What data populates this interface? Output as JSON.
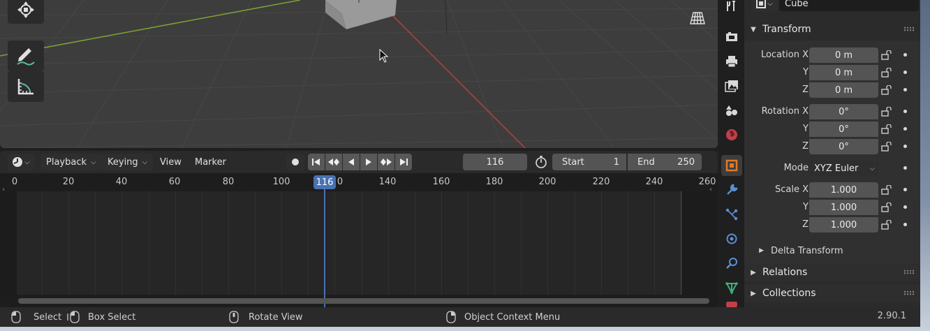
{
  "viewport": {
    "tools": [
      "move-tool",
      "annotate-tool",
      "measure-tool"
    ]
  },
  "timeline": {
    "menus": {
      "playback": "Playback",
      "keying": "Keying",
      "view": "View",
      "marker": "Marker"
    },
    "current_frame": "116",
    "start_label": "Start",
    "start_value": "1",
    "end_label": "End",
    "end_value": "250",
    "ruler_ticks": [
      "0",
      "20",
      "40",
      "60",
      "80",
      "100",
      "0",
      "140",
      "160",
      "180",
      "200",
      "220",
      "240",
      "260"
    ],
    "playhead_label": "116"
  },
  "properties": {
    "object_name": "Cube",
    "transform_title": "Transform",
    "location_label": "Location X",
    "location": [
      "0 m",
      "0 m",
      "0 m"
    ],
    "rotation_label": "Rotation X",
    "rotation": [
      "0°",
      "0°",
      "0°"
    ],
    "mode_label": "Mode",
    "mode_value": "XYZ Euler",
    "scale_label": "Scale X",
    "scale": [
      "1.000",
      "1.000",
      "1.000"
    ],
    "axis_y": "Y",
    "axis_z": "Z",
    "delta_transform": "Delta Transform",
    "relations": "Relations",
    "collections": "Collections"
  },
  "statusbar": {
    "select": "Select",
    "box_select": "Box Select",
    "rotate_view": "Rotate View",
    "context_menu": "Object Context Menu",
    "version": "2.90.1"
  },
  "colors": {
    "accent": "#4772b3",
    "active_tab": "#e07a28",
    "x_axis": "#c9393d",
    "y_axis": "#7ea332"
  }
}
